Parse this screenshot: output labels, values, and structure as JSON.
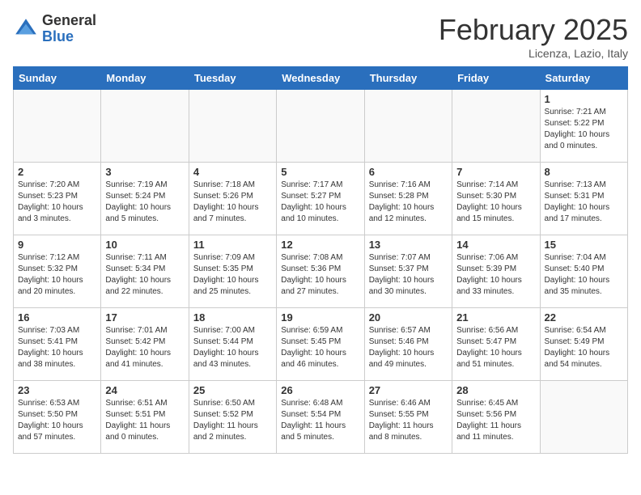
{
  "logo": {
    "general": "General",
    "blue": "Blue"
  },
  "title": "February 2025",
  "location": "Licenza, Lazio, Italy",
  "days_of_week": [
    "Sunday",
    "Monday",
    "Tuesday",
    "Wednesday",
    "Thursday",
    "Friday",
    "Saturday"
  ],
  "weeks": [
    [
      {
        "day": "",
        "info": ""
      },
      {
        "day": "",
        "info": ""
      },
      {
        "day": "",
        "info": ""
      },
      {
        "day": "",
        "info": ""
      },
      {
        "day": "",
        "info": ""
      },
      {
        "day": "",
        "info": ""
      },
      {
        "day": "1",
        "info": "Sunrise: 7:21 AM\nSunset: 5:22 PM\nDaylight: 10 hours and 0 minutes."
      }
    ],
    [
      {
        "day": "2",
        "info": "Sunrise: 7:20 AM\nSunset: 5:23 PM\nDaylight: 10 hours and 3 minutes."
      },
      {
        "day": "3",
        "info": "Sunrise: 7:19 AM\nSunset: 5:24 PM\nDaylight: 10 hours and 5 minutes."
      },
      {
        "day": "4",
        "info": "Sunrise: 7:18 AM\nSunset: 5:26 PM\nDaylight: 10 hours and 7 minutes."
      },
      {
        "day": "5",
        "info": "Sunrise: 7:17 AM\nSunset: 5:27 PM\nDaylight: 10 hours and 10 minutes."
      },
      {
        "day": "6",
        "info": "Sunrise: 7:16 AM\nSunset: 5:28 PM\nDaylight: 10 hours and 12 minutes."
      },
      {
        "day": "7",
        "info": "Sunrise: 7:14 AM\nSunset: 5:30 PM\nDaylight: 10 hours and 15 minutes."
      },
      {
        "day": "8",
        "info": "Sunrise: 7:13 AM\nSunset: 5:31 PM\nDaylight: 10 hours and 17 minutes."
      }
    ],
    [
      {
        "day": "9",
        "info": "Sunrise: 7:12 AM\nSunset: 5:32 PM\nDaylight: 10 hours and 20 minutes."
      },
      {
        "day": "10",
        "info": "Sunrise: 7:11 AM\nSunset: 5:34 PM\nDaylight: 10 hours and 22 minutes."
      },
      {
        "day": "11",
        "info": "Sunrise: 7:09 AM\nSunset: 5:35 PM\nDaylight: 10 hours and 25 minutes."
      },
      {
        "day": "12",
        "info": "Sunrise: 7:08 AM\nSunset: 5:36 PM\nDaylight: 10 hours and 27 minutes."
      },
      {
        "day": "13",
        "info": "Sunrise: 7:07 AM\nSunset: 5:37 PM\nDaylight: 10 hours and 30 minutes."
      },
      {
        "day": "14",
        "info": "Sunrise: 7:06 AM\nSunset: 5:39 PM\nDaylight: 10 hours and 33 minutes."
      },
      {
        "day": "15",
        "info": "Sunrise: 7:04 AM\nSunset: 5:40 PM\nDaylight: 10 hours and 35 minutes."
      }
    ],
    [
      {
        "day": "16",
        "info": "Sunrise: 7:03 AM\nSunset: 5:41 PM\nDaylight: 10 hours and 38 minutes."
      },
      {
        "day": "17",
        "info": "Sunrise: 7:01 AM\nSunset: 5:42 PM\nDaylight: 10 hours and 41 minutes."
      },
      {
        "day": "18",
        "info": "Sunrise: 7:00 AM\nSunset: 5:44 PM\nDaylight: 10 hours and 43 minutes."
      },
      {
        "day": "19",
        "info": "Sunrise: 6:59 AM\nSunset: 5:45 PM\nDaylight: 10 hours and 46 minutes."
      },
      {
        "day": "20",
        "info": "Sunrise: 6:57 AM\nSunset: 5:46 PM\nDaylight: 10 hours and 49 minutes."
      },
      {
        "day": "21",
        "info": "Sunrise: 6:56 AM\nSunset: 5:47 PM\nDaylight: 10 hours and 51 minutes."
      },
      {
        "day": "22",
        "info": "Sunrise: 6:54 AM\nSunset: 5:49 PM\nDaylight: 10 hours and 54 minutes."
      }
    ],
    [
      {
        "day": "23",
        "info": "Sunrise: 6:53 AM\nSunset: 5:50 PM\nDaylight: 10 hours and 57 minutes."
      },
      {
        "day": "24",
        "info": "Sunrise: 6:51 AM\nSunset: 5:51 PM\nDaylight: 11 hours and 0 minutes."
      },
      {
        "day": "25",
        "info": "Sunrise: 6:50 AM\nSunset: 5:52 PM\nDaylight: 11 hours and 2 minutes."
      },
      {
        "day": "26",
        "info": "Sunrise: 6:48 AM\nSunset: 5:54 PM\nDaylight: 11 hours and 5 minutes."
      },
      {
        "day": "27",
        "info": "Sunrise: 6:46 AM\nSunset: 5:55 PM\nDaylight: 11 hours and 8 minutes."
      },
      {
        "day": "28",
        "info": "Sunrise: 6:45 AM\nSunset: 5:56 PM\nDaylight: 11 hours and 11 minutes."
      },
      {
        "day": "",
        "info": ""
      }
    ]
  ]
}
